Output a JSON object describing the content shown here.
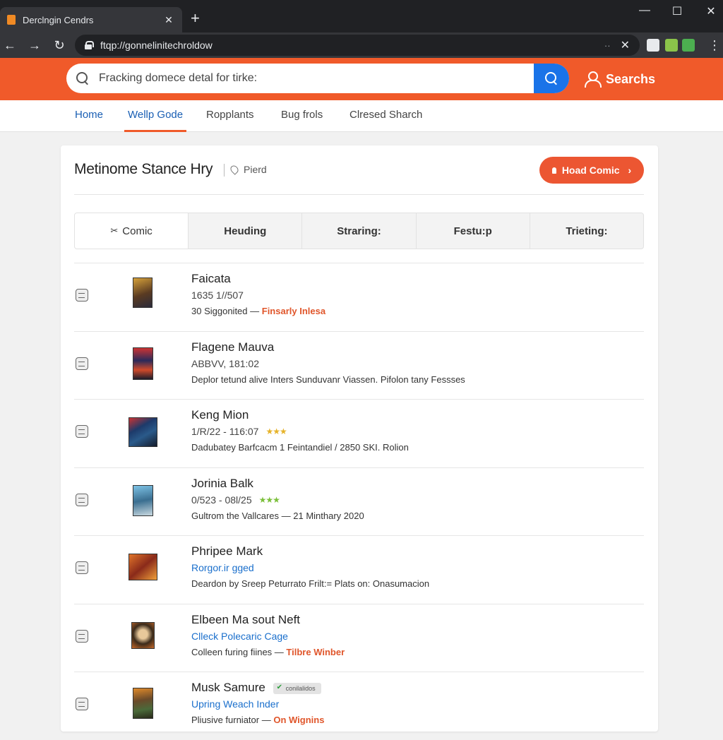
{
  "browser": {
    "tab_title": "Derclngin Cendrs",
    "tab_close": "✕",
    "new_tab": "+",
    "url": "ftqp://gonnelinitechroldow",
    "omni_right": "··",
    "omni_x": "✕",
    "controls": {
      "minimize": "—",
      "maximize": "☐",
      "close": "✕"
    },
    "nav": {
      "back": "←",
      "forward": "→",
      "reload": "↻"
    },
    "ext_colors": [
      "#e8eaed",
      "#8bc34a",
      "#4caf50"
    ]
  },
  "header": {
    "search_placeholder": "Fracking domece detal for tirke:",
    "search_link": "Searchs",
    "accent": "#f05a2a",
    "search_button_color": "#1a73e8"
  },
  "nav": {
    "items": [
      "Home",
      "Wellp Gode",
      "Ropplants",
      "Bug frols",
      "Clresed Sharch"
    ]
  },
  "card": {
    "title": "Metinome Stance Hry",
    "subtitle": "Pierd",
    "button_label": "Hoad Comic",
    "tabs": [
      "Comic",
      "Heuding",
      "Straring:",
      "Festu:p",
      "Trieting:"
    ],
    "rows": [
      {
        "title": "Faicata",
        "meta": "1635 1//507",
        "desc": "30 Siggonited —",
        "desc_hl": "Finsarly Inlesa",
        "stars": ""
      },
      {
        "title": "Flagene Mauva",
        "meta": "ABBVV, 181:02",
        "desc": "Deplor tetund alive Inters Sunduvanr Viassen. Pifolon tany Fessses",
        "desc_hl": "",
        "stars": ""
      },
      {
        "title": "Keng Mion",
        "meta": "1/R/22 - 116:07",
        "desc": "Dadubatey Barfcacm 1 Feintandiel / 2850 SKI. Rolion",
        "desc_hl": "",
        "stars": "★★★"
      },
      {
        "title": "Jorinia Balk",
        "meta": "0/523 - 08l/25",
        "desc": "Gultrom the Vallcares — 21 Minthary 2020",
        "desc_hl": "",
        "stars": "★★★"
      },
      {
        "title": "Phripee Mark",
        "meta": "Rorgor.ir gged",
        "desc": "Deardon by Sreep Peturrato Frilt:= Plats on: Onasumacion",
        "desc_hl": "",
        "stars": ""
      },
      {
        "title": "Elbeen Ma sout Neft",
        "meta": "Clleck Polecaric Cage",
        "desc": "Colleen furing fiines —",
        "desc_hl": "Tilbre Winber",
        "stars": ""
      },
      {
        "title": "Musk Samure",
        "badge": "conilalidos",
        "meta": "Upring Weach Inder",
        "desc": "Pliusive furniator —",
        "desc_hl": "On Wignins",
        "stars": ""
      }
    ]
  }
}
